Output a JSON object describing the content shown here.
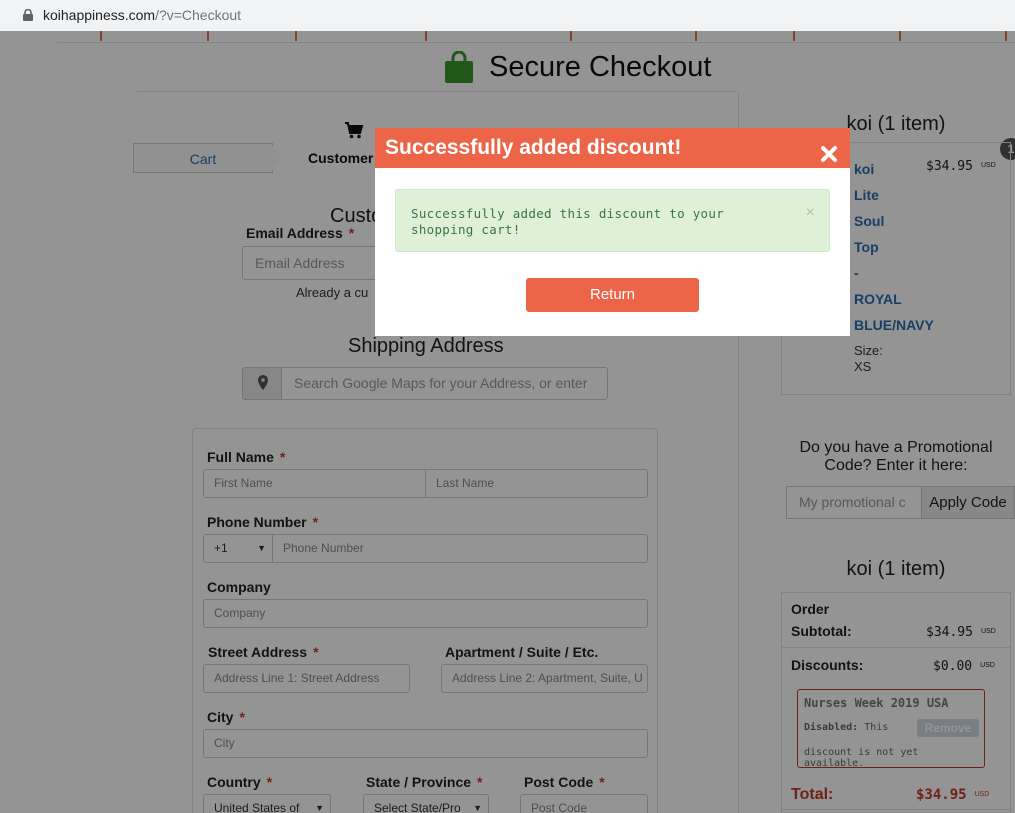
{
  "browser": {
    "url_host": "koihappiness.com",
    "url_path": "/?v=Checkout"
  },
  "header": {
    "title": "Secure Checkout"
  },
  "steps": {
    "cart": "Cart",
    "customer": "Customer I"
  },
  "customer": {
    "heading": "Custo",
    "email_label": "Email Address",
    "required_mark": "*",
    "email_placeholder": "Email Address",
    "already_text": "Already a cu"
  },
  "shipping": {
    "heading": "Shipping Address",
    "search_placeholder": "Search Google Maps for your Address, or enter",
    "full_name_label": "Full Name",
    "first_name_placeholder": "First Name",
    "last_name_placeholder": "Last Name",
    "phone_label": "Phone Number",
    "phone_code": "+1",
    "phone_placeholder": "Phone Number",
    "company_label": "Company",
    "company_placeholder": "Company",
    "street_label": "Street Address",
    "street_placeholder": "Address Line 1: Street Address",
    "apt_label": "Apartment / Suite / Etc.",
    "apt_placeholder": "Address Line 2: Apartment, Suite, U",
    "city_label": "City",
    "city_placeholder": "City",
    "country_label": "Country",
    "country_value": "United States of",
    "state_label": "State / Province",
    "state_value": "Select State/Pro",
    "post_label": "Post Code",
    "post_placeholder": "Post Code"
  },
  "cart": {
    "title": "koi (1 item)",
    "badge": "1",
    "item_name_lines": [
      "koi",
      "Lite",
      "Soul",
      "Top",
      "-",
      "ROYAL",
      "BLUE/NAVY"
    ],
    "item_price": "$34.95",
    "currency": "USD",
    "size_label": "Size:",
    "size_value": "XS"
  },
  "promo": {
    "question": "Do you have a Promotional Code? Enter it here:",
    "placeholder": "My promotional c",
    "apply_label": "Apply Code"
  },
  "summary": {
    "title": "koi (1 item)",
    "subtotal_label_1": "Order",
    "subtotal_label_2": "Subtotal:",
    "subtotal_value": "$34.95",
    "discounts_label": "Discounts:",
    "discounts_value": "$0.00",
    "discount_name": "Nurses Week 2019 USA",
    "discount_status": "Disabled:",
    "discount_note_1": "This",
    "discount_note_2": "discount is not yet available.",
    "remove_label": "Remove",
    "total_label": "Total:",
    "total_value": "$34.95",
    "currency": "USD"
  },
  "modal": {
    "title": "Successfully added discount!",
    "message": "Successfully added this discount to your shopping cart!",
    "dismiss": "×",
    "return_label": "Return"
  },
  "colors": {
    "accent": "#ed6549",
    "success_bg": "#dff0d8",
    "success_text": "#3c763d",
    "link": "#2b6cb0",
    "bag_green": "#3c9a2f"
  }
}
